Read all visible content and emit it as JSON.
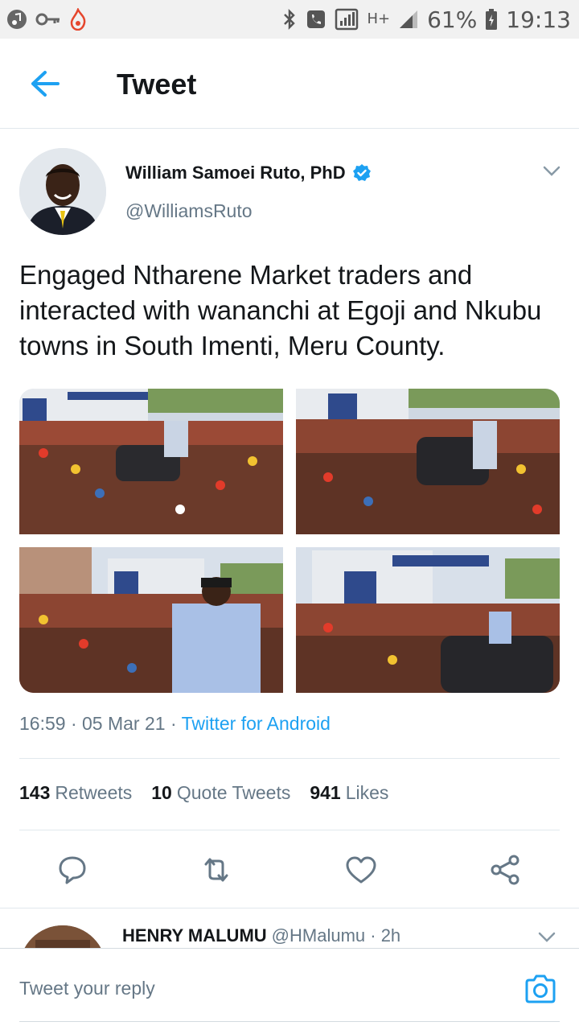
{
  "status_bar": {
    "battery": "61%",
    "time": "19:13",
    "network": "H+"
  },
  "header": {
    "title": "Tweet"
  },
  "tweet": {
    "author_name": "William Samoei Ruto, PhD",
    "author_handle": "@WilliamsRuto",
    "text": "Engaged Ntharene Market traders and interacted with wananchi at Egoji and Nkubu towns in South Imenti, Meru County.",
    "timestamp": "16:59 · 05 Mar 21 · ",
    "client": "Twitter for Android",
    "stats": {
      "retweets_count": "143",
      "retweets_label": "Retweets",
      "quotes_count": "10",
      "quotes_label": "Quote Tweets",
      "likes_count": "941",
      "likes_label": "Likes"
    },
    "actions": [
      "reply-icon",
      "retweet-icon",
      "like-icon",
      "share-icon"
    ]
  },
  "reply_preview": {
    "author_name": "HENRY MALUMU",
    "author_handle": "@HMalumu · 2h"
  },
  "reply_bar": {
    "placeholder": "Tweet your reply"
  },
  "colors": {
    "accent": "#1da1f2",
    "text": "#14171a",
    "secondary": "#657786",
    "divider": "#e1e8ed"
  }
}
